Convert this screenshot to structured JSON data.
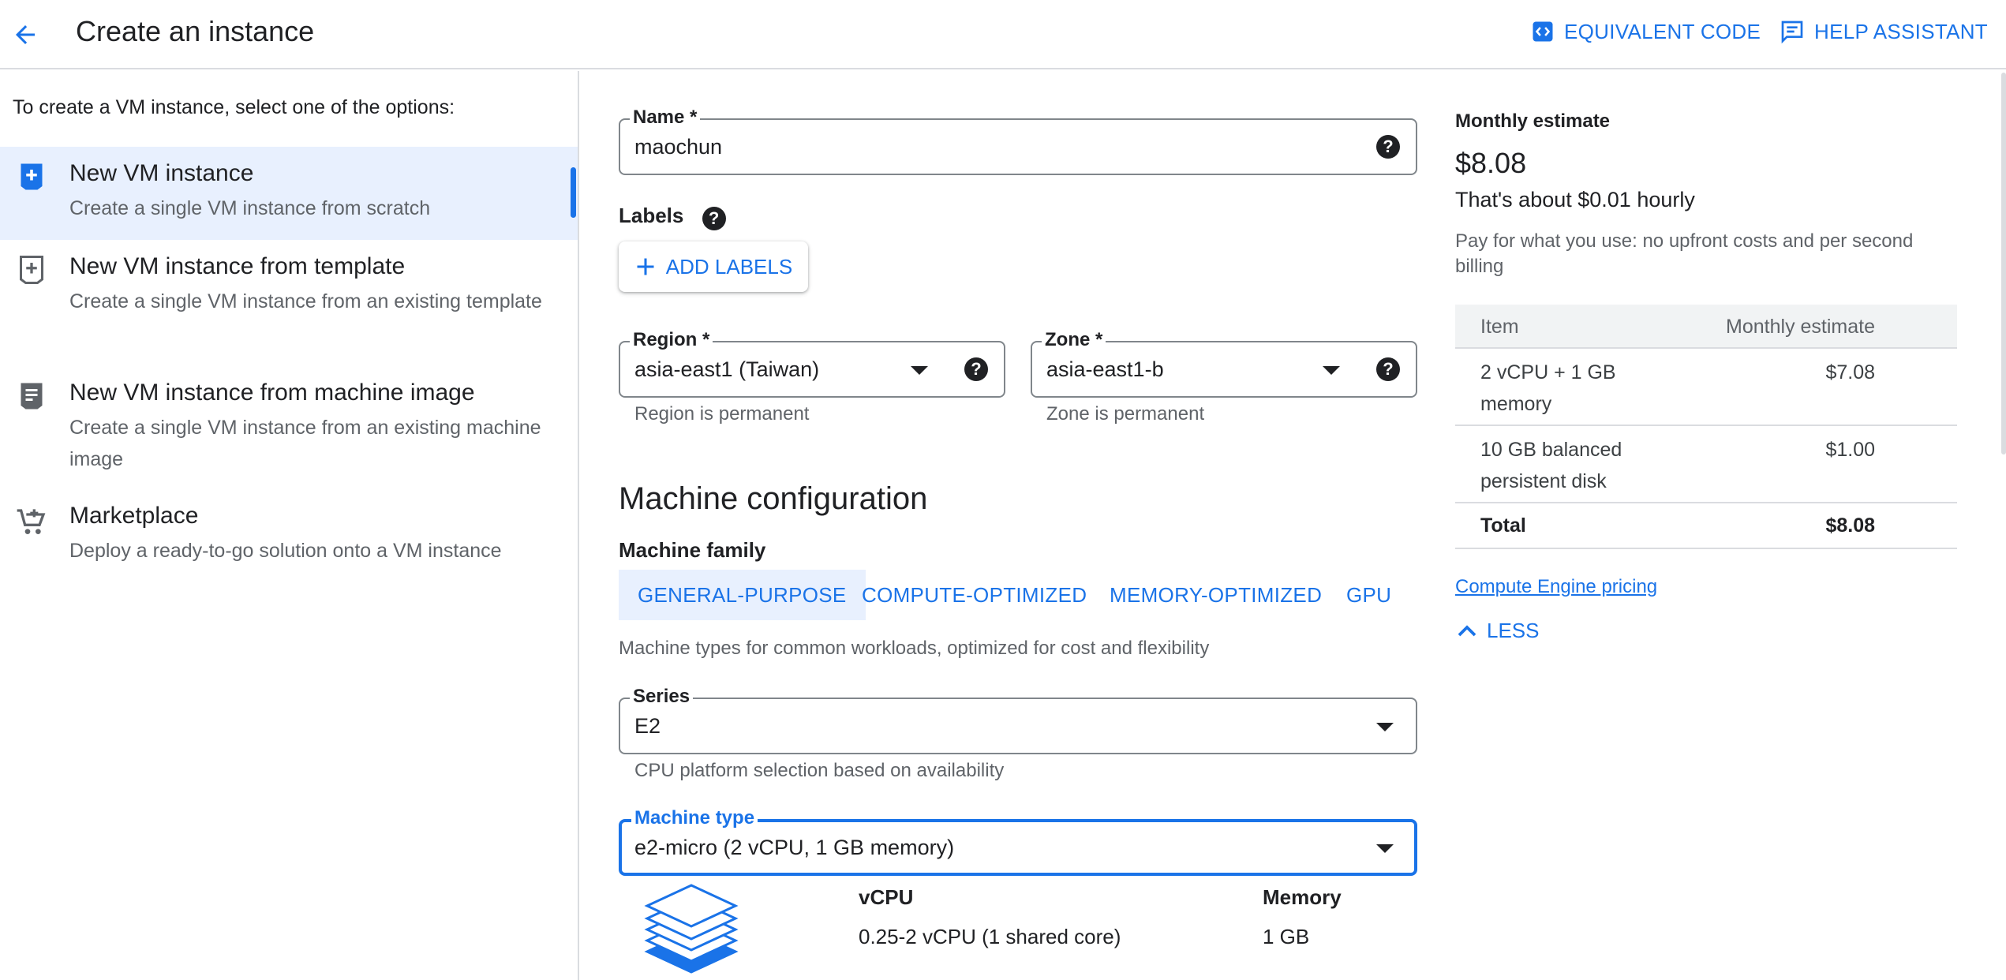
{
  "header": {
    "title": "Create an instance",
    "equivalent_code": "EQUIVALENT CODE",
    "help_assistant": "HELP ASSISTANT"
  },
  "left": {
    "prompt": "To create a VM instance, select one of the options:",
    "options": [
      {
        "title": "New VM instance",
        "desc": "Create a single VM instance from scratch",
        "icon": "add-box-icon",
        "selected": true
      },
      {
        "title": "New VM instance from template",
        "desc": "Create a single VM instance from an existing template",
        "icon": "template-icon"
      },
      {
        "title": "New VM instance from machine image",
        "desc": "Create a single VM instance from an existing machine image",
        "icon": "machine-image-icon"
      },
      {
        "title": "Marketplace",
        "desc": "Deploy a ready-to-go solution onto a VM instance",
        "icon": "cart-icon"
      }
    ]
  },
  "form": {
    "name": {
      "label": "Name *",
      "value": "maochun"
    },
    "labels": {
      "title": "Labels",
      "add_button": "ADD LABELS"
    },
    "region": {
      "label": "Region *",
      "value": "asia-east1 (Taiwan)",
      "hint": "Region is permanent"
    },
    "zone": {
      "label": "Zone *",
      "value": "asia-east1-b",
      "hint": "Zone is permanent"
    }
  },
  "machine": {
    "title": "Machine configuration",
    "family_label": "Machine family",
    "tabs": [
      "GENERAL-PURPOSE",
      "COMPUTE-OPTIMIZED",
      "MEMORY-OPTIMIZED",
      "GPU"
    ],
    "active_tab": 0,
    "family_desc": "Machine types for common workloads, optimized for cost and flexibility",
    "series": {
      "label": "Series",
      "value": "E2",
      "hint": "CPU platform selection based on availability"
    },
    "type": {
      "label": "Machine type",
      "value": "e2-micro (2 vCPU, 1 GB memory)"
    },
    "specs": {
      "vcpu_label": "vCPU",
      "vcpu_value": "0.25-2 vCPU (1 shared core)",
      "memory_label": "Memory",
      "memory_value": "1 GB"
    }
  },
  "estimate": {
    "label": "Monthly estimate",
    "price": "$8.08",
    "hourly": "That's about $0.01 hourly",
    "pay_note": "Pay for what you use: no upfront costs and per second billing",
    "table": {
      "headers": [
        "Item",
        "Monthly estimate"
      ],
      "rows": [
        {
          "item": "2 vCPU + 1 GB memory",
          "cost": "$7.08"
        },
        {
          "item": "10 GB balanced persistent disk",
          "cost": "$1.00"
        }
      ],
      "total_label": "Total",
      "total_value": "$8.08"
    },
    "pricing_link": "Compute Engine pricing",
    "less": "LESS"
  },
  "colors": {
    "accent": "#1a73e8",
    "selected_bg": "#e8f0fe",
    "text": "#202124",
    "muted": "#5f6368",
    "border": "#dadce0"
  }
}
